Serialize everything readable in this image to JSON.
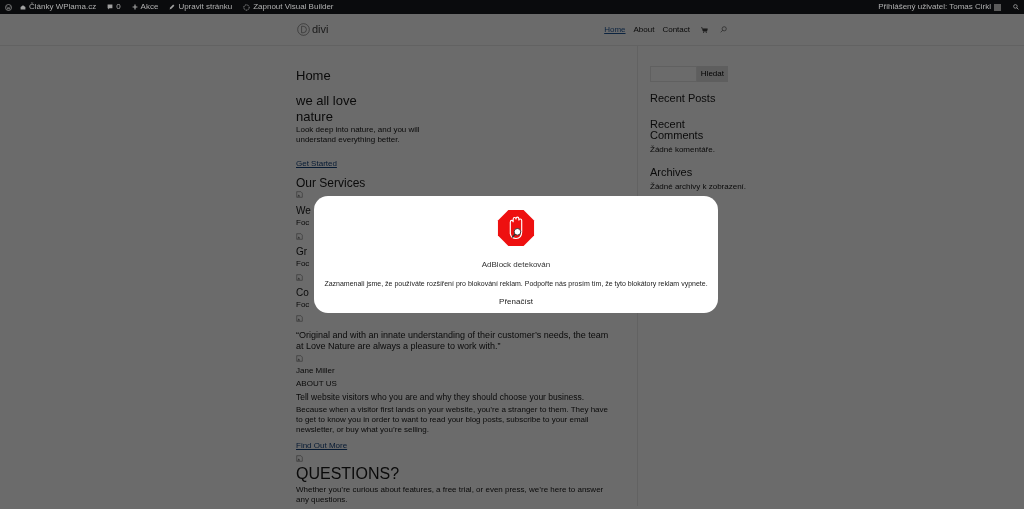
{
  "admin_bar": {
    "items": [
      {
        "kind": "wp-logo"
      },
      {
        "kind": "site",
        "label": "Články WPlama.cz"
      },
      {
        "kind": "comments",
        "label": "0"
      },
      {
        "kind": "new",
        "label": "Akce"
      },
      {
        "kind": "edit",
        "label": "Upravit stránku"
      },
      {
        "kind": "builder",
        "label": "Zapnout Visual Builder"
      }
    ],
    "user": "Přihlášený uživatel: Tomas Cirkl"
  },
  "header": {
    "logo_text": "divi",
    "nav": [
      {
        "label": "Home",
        "selected": true
      },
      {
        "label": "About",
        "selected": false
      },
      {
        "label": "Contact",
        "selected": false
      }
    ]
  },
  "main": {
    "blocks": [
      {
        "kind": "page-title",
        "text": "Home"
      },
      {
        "kind": "hero",
        "text": "we all love nature"
      },
      {
        "kind": "lead",
        "text": "Look deep into nature, and you will understand everything better."
      },
      {
        "kind": "link",
        "text": "Get Started"
      },
      {
        "kind": "section",
        "text": "Our Services"
      },
      {
        "kind": "image"
      },
      {
        "kind": "service",
        "text": "We"
      },
      {
        "kind": "small",
        "text": "Foc"
      },
      {
        "kind": "image"
      },
      {
        "kind": "service",
        "text": "Gr"
      },
      {
        "kind": "small",
        "text": "Foc"
      },
      {
        "kind": "image"
      },
      {
        "kind": "service",
        "text": "Co"
      },
      {
        "kind": "small",
        "text": "Foc"
      },
      {
        "kind": "image"
      },
      {
        "kind": "quote",
        "text": "“Original and with an innate understanding of their customer’s needs, the team at Love Nature are always a pleasure to work with.”"
      },
      {
        "kind": "image"
      },
      {
        "kind": "small",
        "text": "Jane Miller"
      },
      {
        "kind": "small",
        "text": "ABOUT US"
      },
      {
        "kind": "subheading",
        "text": "Tell website visitors who you are and why they should choose your business."
      },
      {
        "kind": "body",
        "text": "Because when a visitor first lands on your website, you’re a stranger to them. They have to get to know you in order to want to read your blog posts, subscribe to your email newsletter, or buy what you’re selling."
      },
      {
        "kind": "link",
        "text": "Find Out More"
      },
      {
        "kind": "image"
      },
      {
        "kind": "big",
        "text": "QUESTIONS?"
      },
      {
        "kind": "body",
        "text": "Whether you’re curious about features, a free trial, or even press, we’re here to answer any questions."
      }
    ]
  },
  "sidebar": {
    "search_button": "Hledat",
    "widgets": [
      {
        "title": "Recent Posts"
      },
      {
        "title": "Recent Comments",
        "text": "Žádné komentáře."
      },
      {
        "title": "Archives",
        "text": "Žádné archivy k zobrazení."
      }
    ]
  },
  "modal": {
    "title": "AdBlock detekován",
    "message": "Zaznamenali jsme, že používáte rozšíření pro blokování reklam. Podpořte nás prosím tím, že tyto blokátory reklam vypnete.",
    "button": "Přenačíst"
  }
}
